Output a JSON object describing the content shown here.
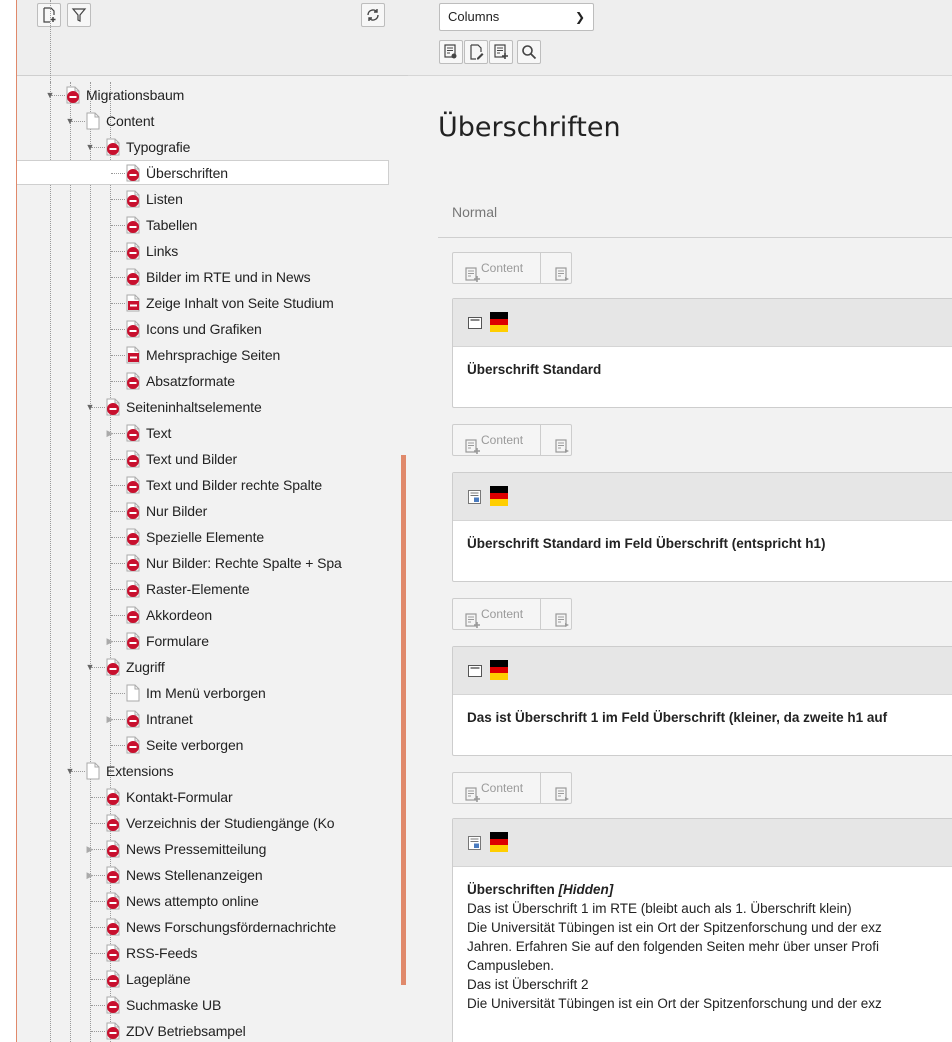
{
  "tree_toolbar": {
    "new_page_icon": "new-page-icon",
    "filter_icon": "filter-icon",
    "refresh_icon": "refresh-icon"
  },
  "content_toolbar": {
    "view_mode": "Columns",
    "buttons": [
      "view-page-icon",
      "edit-page-icon",
      "new-content-icon",
      "search-icon"
    ]
  },
  "tree": [
    {
      "label": "Migrationsbaum",
      "depth": 0,
      "icon": "page-restricted",
      "expanded": true
    },
    {
      "label": "Content",
      "depth": 1,
      "icon": "page-plain",
      "expanded": true
    },
    {
      "label": "Typografie",
      "depth": 2,
      "icon": "page-restricted",
      "expanded": true
    },
    {
      "label": "Überschriften",
      "depth": 3,
      "icon": "page-restricted",
      "selected": true
    },
    {
      "label": "Listen",
      "depth": 3,
      "icon": "page-restricted"
    },
    {
      "label": "Tabellen",
      "depth": 3,
      "icon": "page-restricted"
    },
    {
      "label": "Links",
      "depth": 3,
      "icon": "page-restricted"
    },
    {
      "label": "Bilder im RTE und in News",
      "depth": 3,
      "icon": "page-restricted"
    },
    {
      "label": "Zeige Inhalt von Seite Studium",
      "depth": 3,
      "icon": "page-shortcut"
    },
    {
      "label": "Icons und Grafiken",
      "depth": 3,
      "icon": "page-restricted"
    },
    {
      "label": "Mehrsprachige Seiten",
      "depth": 3,
      "icon": "page-shortcut"
    },
    {
      "label": "Absatzformate",
      "depth": 3,
      "icon": "page-restricted"
    },
    {
      "label": "Seiteninhaltselemente",
      "depth": 2,
      "icon": "page-restricted",
      "expanded": true
    },
    {
      "label": "Text",
      "depth": 3,
      "icon": "page-restricted",
      "collapsed": true
    },
    {
      "label": "Text und Bilder",
      "depth": 3,
      "icon": "page-restricted"
    },
    {
      "label": "Text und Bilder rechte Spalte",
      "depth": 3,
      "icon": "page-restricted"
    },
    {
      "label": "Nur Bilder",
      "depth": 3,
      "icon": "page-restricted"
    },
    {
      "label": "Spezielle Elemente",
      "depth": 3,
      "icon": "page-restricted"
    },
    {
      "label": "Nur Bilder: Rechte Spalte + Spa",
      "depth": 3,
      "icon": "page-restricted"
    },
    {
      "label": "Raster-Elemente",
      "depth": 3,
      "icon": "page-restricted"
    },
    {
      "label": "Akkordeon",
      "depth": 3,
      "icon": "page-restricted"
    },
    {
      "label": "Formulare",
      "depth": 3,
      "icon": "page-restricted",
      "collapsed": true
    },
    {
      "label": "Zugriff",
      "depth": 2,
      "icon": "page-restricted",
      "expanded": true
    },
    {
      "label": "Im Menü verborgen",
      "depth": 3,
      "icon": "page-plain"
    },
    {
      "label": "Intranet",
      "depth": 3,
      "icon": "page-restricted",
      "collapsed": true
    },
    {
      "label": "Seite verborgen",
      "depth": 3,
      "icon": "page-restricted"
    },
    {
      "label": "Extensions",
      "depth": 1,
      "icon": "page-plain",
      "expanded": true
    },
    {
      "label": "Kontakt-Formular",
      "depth": 2,
      "icon": "page-restricted"
    },
    {
      "label": "Verzeichnis der Studiengänge (Ko",
      "depth": 2,
      "icon": "page-restricted"
    },
    {
      "label": "News Pressemitteilung",
      "depth": 2,
      "icon": "page-restricted",
      "collapsed": true
    },
    {
      "label": "News Stellenanzeigen",
      "depth": 2,
      "icon": "page-restricted",
      "collapsed": true
    },
    {
      "label": "News attempto online",
      "depth": 2,
      "icon": "page-restricted"
    },
    {
      "label": "News Forschungsfördernachrichte",
      "depth": 2,
      "icon": "page-restricted"
    },
    {
      "label": "RSS-Feeds",
      "depth": 2,
      "icon": "page-restricted"
    },
    {
      "label": "Lagepläne",
      "depth": 2,
      "icon": "page-restricted"
    },
    {
      "label": "Suchmaske UB",
      "depth": 2,
      "icon": "page-restricted"
    },
    {
      "label": "ZDV Betriebsampel",
      "depth": 2,
      "icon": "page-restricted"
    }
  ],
  "page": {
    "title": "Überschriften",
    "column": "Normal",
    "new_content_label": "Content",
    "elements": [
      {
        "type": "header",
        "title": "Überschrift Standard",
        "lines": []
      },
      {
        "type": "text",
        "title": "Überschrift Standard im Feld Überschrift (entspricht h1)",
        "lines": []
      },
      {
        "type": "header",
        "title": "Das ist Überschrift 1 im Feld Überschrift (kleiner, da zweite h1 auf",
        "lines": []
      },
      {
        "type": "text",
        "title": "Überschriften",
        "hidden_tag": "[Hidden]",
        "lines": [
          "Das ist Überschrift 1 im RTE (bleibt auch als 1. Überschrift klein)",
          "Die Universität Tübingen ist ein Ort der Spitzenforschung und der exz",
          "Jahren. Erfahren Sie auf den folgenden Seiten mehr über unser Profi",
          "Campusleben.",
          "Das ist Überschrift 2",
          "Die Universität Tübingen ist ein Ort der Spitzenforschung und der exz"
        ]
      }
    ]
  },
  "colors": {
    "accent": "#e0896b",
    "restricted_red": "#c8102e",
    "flag_black": "#000000",
    "flag_red": "#dd0000",
    "flag_gold": "#ffce00"
  }
}
